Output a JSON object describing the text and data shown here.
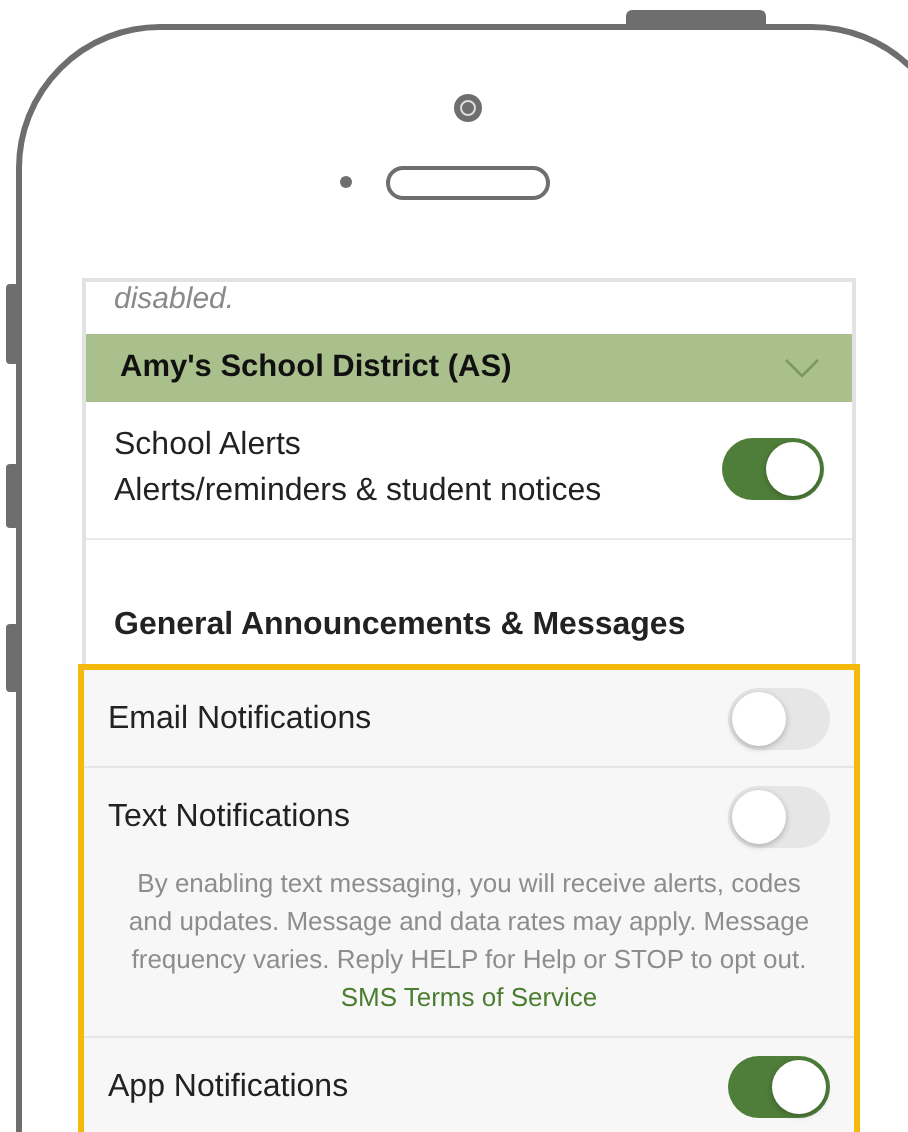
{
  "note_fragment": "disabled.",
  "district": {
    "name": "Amy's School District (AS)",
    "expanded": false
  },
  "school_alerts": {
    "title": "School Alerts",
    "subtitle": "Alerts/reminders & student notices",
    "on": true
  },
  "section_title": "General Announcements & Messages",
  "highlighted_settings": [
    {
      "label": "Email Notifications",
      "on": false
    },
    {
      "label": "Text Notifications",
      "on": false,
      "disclaimer": "By enabling text messaging, you will receive alerts, codes and updates. Message and data rates may apply. Message frequency varies. Reply HELP for Help or STOP to opt out.",
      "link": "SMS Terms of Service"
    },
    {
      "label": "App Notifications",
      "on": true
    }
  ]
}
